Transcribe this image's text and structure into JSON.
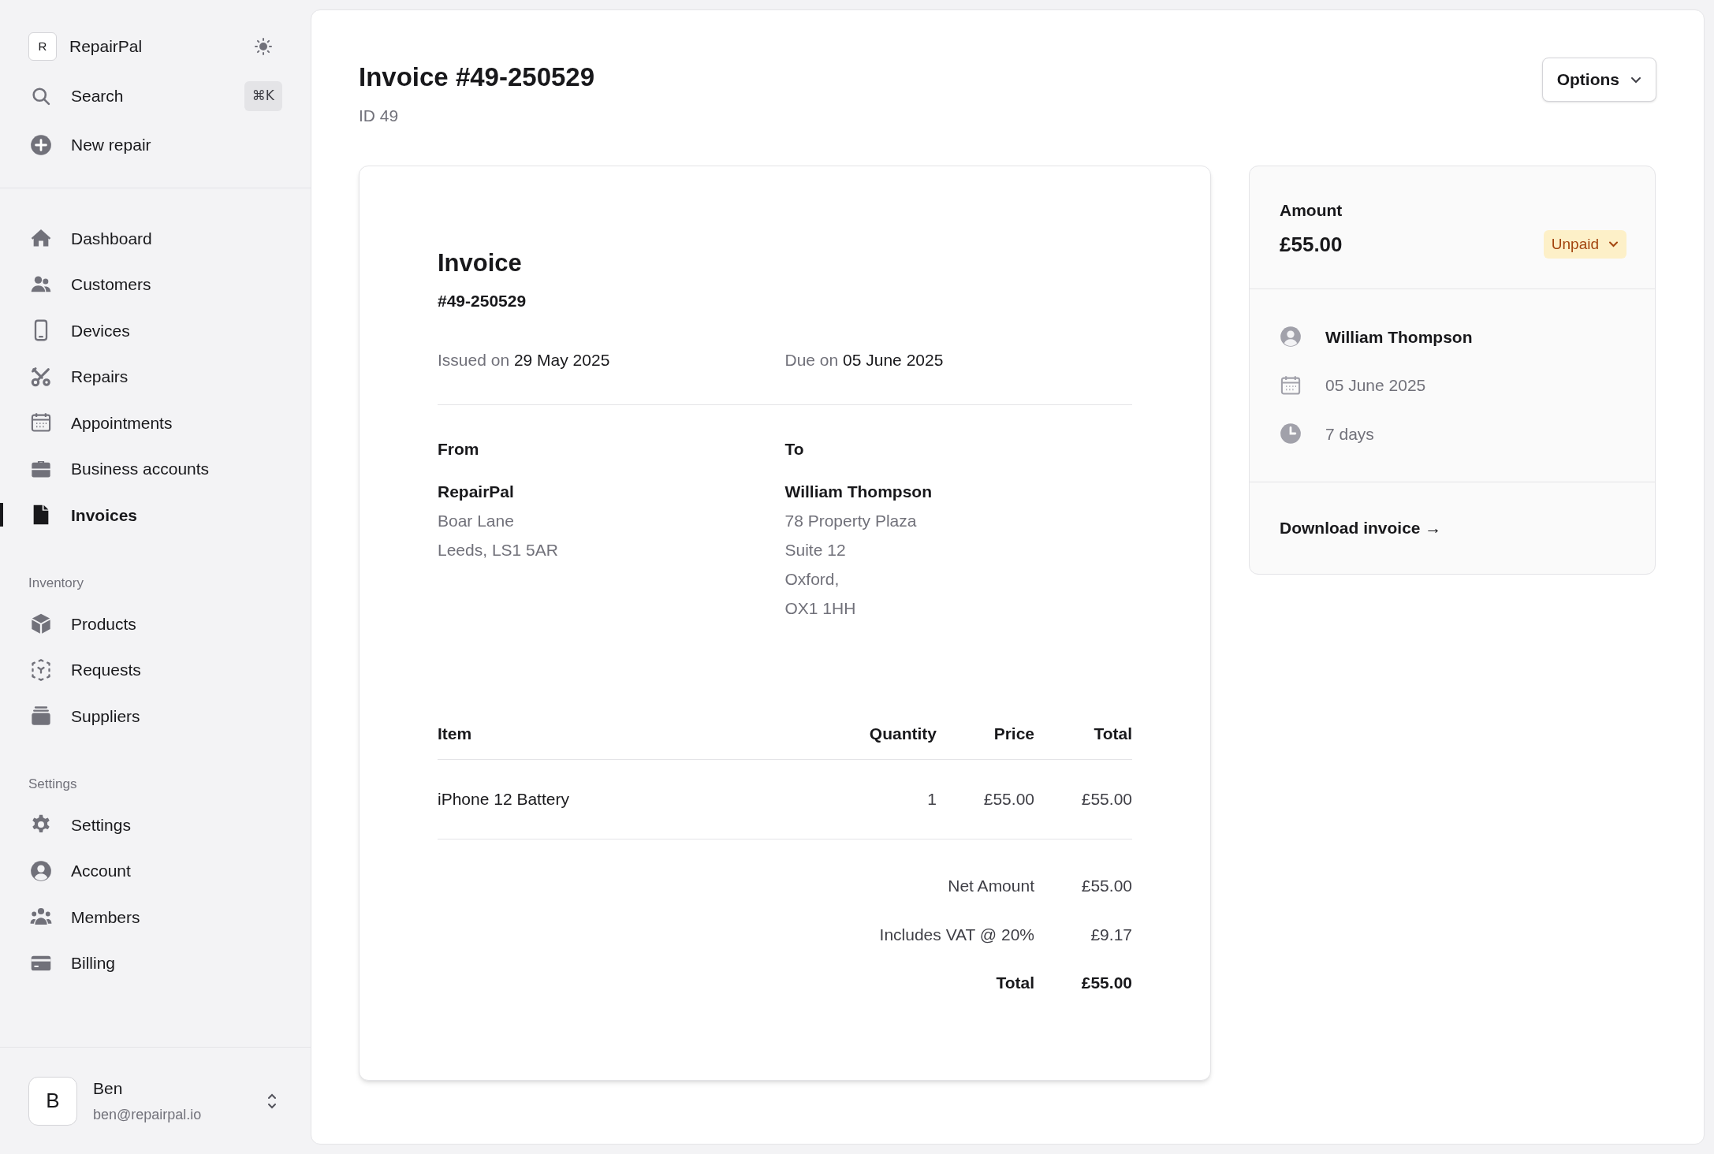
{
  "sidebar": {
    "brand": {
      "initial": "R",
      "name": "RepairPal"
    },
    "search": {
      "label": "Search",
      "shortcut": "⌘K"
    },
    "new_repair": {
      "label": "New repair"
    },
    "main_nav": [
      {
        "label": "Dashboard",
        "selected": false
      },
      {
        "label": "Customers",
        "selected": false
      },
      {
        "label": "Devices",
        "selected": false
      },
      {
        "label": "Repairs",
        "selected": false
      },
      {
        "label": "Appointments",
        "selected": false
      },
      {
        "label": "Business accounts",
        "selected": false
      },
      {
        "label": "Invoices",
        "selected": true
      }
    ],
    "sections": [
      {
        "title": "Inventory",
        "items": [
          {
            "label": "Products",
            "selected": false
          },
          {
            "label": "Requests",
            "selected": false
          },
          {
            "label": "Suppliers",
            "selected": false
          }
        ]
      },
      {
        "title": "Settings",
        "items": [
          {
            "label": "Settings",
            "selected": false
          },
          {
            "label": "Account",
            "selected": false
          },
          {
            "label": "Members",
            "selected": false
          },
          {
            "label": "Billing",
            "selected": false
          }
        ]
      }
    ],
    "user": {
      "initial": "B",
      "name": "Ben",
      "email": "ben@repairpal.io"
    }
  },
  "header": {
    "title": "Invoice #49-250529",
    "subtitle": "ID 49",
    "options_button": "Options"
  },
  "invoice": {
    "heading": "Invoice",
    "number": "#49-250529",
    "issued_label": "Issued on",
    "issued": "29 May 2025",
    "due_label": "Due on",
    "due": "05 June 2025",
    "from": {
      "label": "From",
      "name": "RepairPal",
      "lines": [
        "Boar Lane",
        "Leeds, LS1 5AR"
      ]
    },
    "to": {
      "label": "To",
      "name": "William Thompson",
      "lines": [
        "78 Property Plaza",
        "Suite 12",
        "Oxford,",
        "OX1 1HH"
      ]
    },
    "table": {
      "columns": [
        "Item",
        "Quantity",
        "Price",
        "Total"
      ],
      "rows": [
        [
          "iPhone 12 Battery",
          "1",
          "£55.00",
          "£55.00"
        ]
      ]
    },
    "totals": [
      {
        "label": "Net Amount",
        "value": "£55.00",
        "kind": "normal"
      },
      {
        "label": "Includes VAT @ 20%",
        "value": "£9.17",
        "kind": "normal"
      },
      {
        "label": "Total",
        "value": "£55.00",
        "kind": "grand"
      }
    ]
  },
  "summary": {
    "amount_label": "Amount",
    "amount": "£55.00",
    "status": "Unpaid",
    "details": [
      {
        "kind": "person",
        "text": "William Thompson"
      },
      {
        "kind": "date",
        "text": "05 June 2025"
      },
      {
        "kind": "duration",
        "text": "7 days"
      }
    ],
    "download": "Download invoice →"
  }
}
